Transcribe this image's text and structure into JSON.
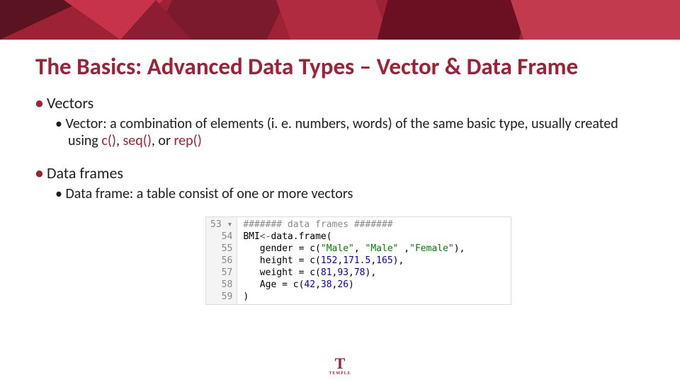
{
  "title": "The Basics: Advanced Data Types – Vector & Data Frame",
  "section1": {
    "heading": "Vectors",
    "line_pre": "Vector: a combination of elements (i. e. numbers, words) of the same basic type, usually created using ",
    "fn1": "c()",
    "comma1": ", ",
    "fn2": "seq()",
    "comma2": ", or ",
    "fn3": "rep()"
  },
  "section2": {
    "heading": "Data frames",
    "line": "Data frame: a table consist of one or more vectors"
  },
  "code": {
    "gutter": [
      "53 ▾",
      "54",
      "55",
      "56",
      "57",
      "58",
      "59"
    ],
    "l53": "####### data frames #######",
    "l54_a": "BMI",
    "l54_b": "<-",
    "l54_c": "data.frame(",
    "l55_a": "   gender = c(",
    "l55_s1": "\"Male\"",
    "l55_c1": ", ",
    "l55_s2": "\"Male\"",
    "l55_c2": " ,",
    "l55_s3": "\"Female\"",
    "l55_e": "),",
    "l56_a": "   height = c(",
    "l56_n1": "152",
    "l56_c1": ",",
    "l56_n2": "171.5",
    "l56_c2": ",",
    "l56_n3": "165",
    "l56_e": "),",
    "l57_a": "   weight = c(",
    "l57_n1": "81",
    "l57_c1": ",",
    "l57_n2": "93",
    "l57_c2": ",",
    "l57_n3": "78",
    "l57_e": "),",
    "l58_a": "   Age = c(",
    "l58_n1": "42",
    "l58_c1": ",",
    "l58_n2": "38",
    "l58_c2": ",",
    "l58_n3": "26",
    "l58_e": ")",
    "l59": ")"
  },
  "logo": {
    "t": "T",
    "sub": "TEMPLE"
  }
}
